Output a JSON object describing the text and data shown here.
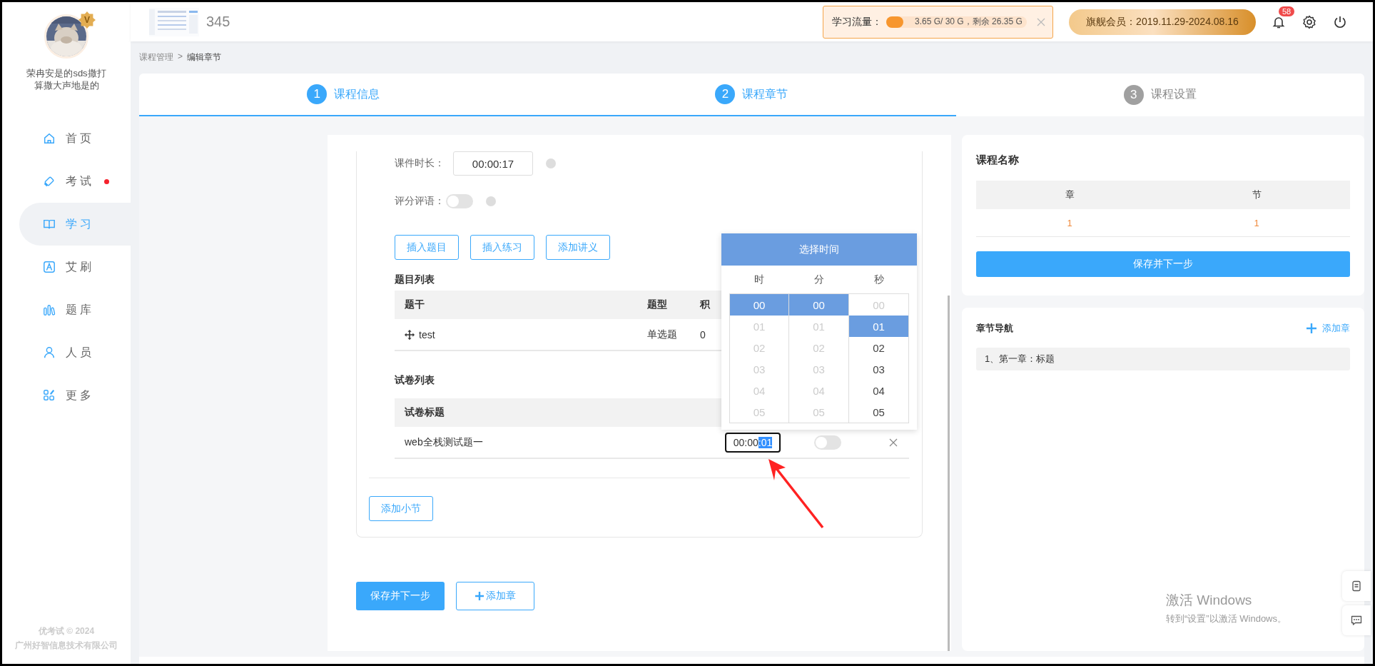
{
  "sidebar": {
    "vip_badge": "V",
    "user_name": "荣冉安是的sds撒打算撒大声地是的",
    "items": [
      {
        "label": "首页",
        "selected": false,
        "dot": false
      },
      {
        "label": "考试",
        "selected": false,
        "dot": true
      },
      {
        "label": "学习",
        "selected": true,
        "dot": false
      },
      {
        "label": "艾刷",
        "selected": false,
        "dot": false
      },
      {
        "label": "题库",
        "selected": false,
        "dot": false
      },
      {
        "label": "人员",
        "selected": false,
        "dot": false
      },
      {
        "label": "更多",
        "selected": false,
        "dot": false
      }
    ],
    "footer": [
      "优考试 © 2024",
      "广州好智信息技术有限公司"
    ]
  },
  "header": {
    "title": "345",
    "traffic": {
      "label": "学习流量：",
      "level": 0.12,
      "reading": "3.65 G/ 30 G，剩余 26.35 G"
    },
    "membership": "旗舰会员：2019.11.29-2024.08.16",
    "notifications": "58"
  },
  "breadcrumb": {
    "items": [
      "课程管理",
      "编辑章节"
    ],
    "separator": ">"
  },
  "steps": [
    {
      "number": "1",
      "label": "课程信息",
      "active": true
    },
    {
      "number": "2",
      "label": "课程章节",
      "active": true
    },
    {
      "number": "3",
      "label": "课程设置",
      "active": false
    }
  ],
  "form": {
    "duration": {
      "label": "课件时长：",
      "value": "00:00:17"
    },
    "comment": {
      "label": "评分评语：",
      "on": false
    },
    "buttons": [
      "插入题目",
      "插入练习",
      "添加讲义"
    ],
    "question_list": {
      "title": "题目列表",
      "columns": [
        "题干",
        "题型",
        "积"
      ],
      "rows": [
        {
          "cells": [
            "test",
            "单选题",
            "0"
          ]
        }
      ]
    },
    "paper_list": {
      "title": "试卷列表",
      "columns": [
        "试卷标题"
      ],
      "rows": [
        {
          "title": "web全栈测试题一",
          "time_value": "00:00",
          "time_highlighted": ":01",
          "on": false
        }
      ]
    },
    "add_section": "添加小节",
    "save": "保存并下一步",
    "add_chapter": "添加章"
  },
  "time_picker": {
    "title": "选择时间",
    "columns": [
      {
        "label": "时",
        "options": [
          {
            "value": "00",
            "selected": true,
            "disabled": false
          },
          {
            "value": "01",
            "selected": false,
            "disabled": true
          },
          {
            "value": "02",
            "selected": false,
            "disabled": true
          },
          {
            "value": "03",
            "selected": false,
            "disabled": true
          },
          {
            "value": "04",
            "selected": false,
            "disabled": true
          },
          {
            "value": "05",
            "selected": false,
            "disabled": true
          }
        ]
      },
      {
        "label": "分",
        "options": [
          {
            "value": "00",
            "selected": true,
            "disabled": false
          },
          {
            "value": "01",
            "selected": false,
            "disabled": true
          },
          {
            "value": "02",
            "selected": false,
            "disabled": true
          },
          {
            "value": "03",
            "selected": false,
            "disabled": true
          },
          {
            "value": "04",
            "selected": false,
            "disabled": true
          },
          {
            "value": "05",
            "selected": false,
            "disabled": true
          }
        ]
      },
      {
        "label": "秒",
        "options": [
          {
            "value": "00",
            "selected": false,
            "disabled": true
          },
          {
            "value": "01",
            "selected": true,
            "disabled": false
          },
          {
            "value": "02",
            "selected": false,
            "disabled": false
          },
          {
            "value": "03",
            "selected": false,
            "disabled": false
          },
          {
            "value": "04",
            "selected": false,
            "disabled": false
          },
          {
            "value": "05",
            "selected": false,
            "disabled": false
          }
        ]
      }
    ]
  },
  "right_panel": {
    "course_title": "课程名称",
    "columns": [
      "章",
      "节"
    ],
    "values": [
      "1",
      "1"
    ],
    "save": "保存并下一步",
    "nav_title": "章节导航",
    "add_chapter": "添加章",
    "chapters": [
      {
        "label": "1、第一章：标题"
      }
    ]
  },
  "activation_notice": {
    "title": "激活 Windows",
    "text": "转到“设置”以激活 Windows。"
  }
}
